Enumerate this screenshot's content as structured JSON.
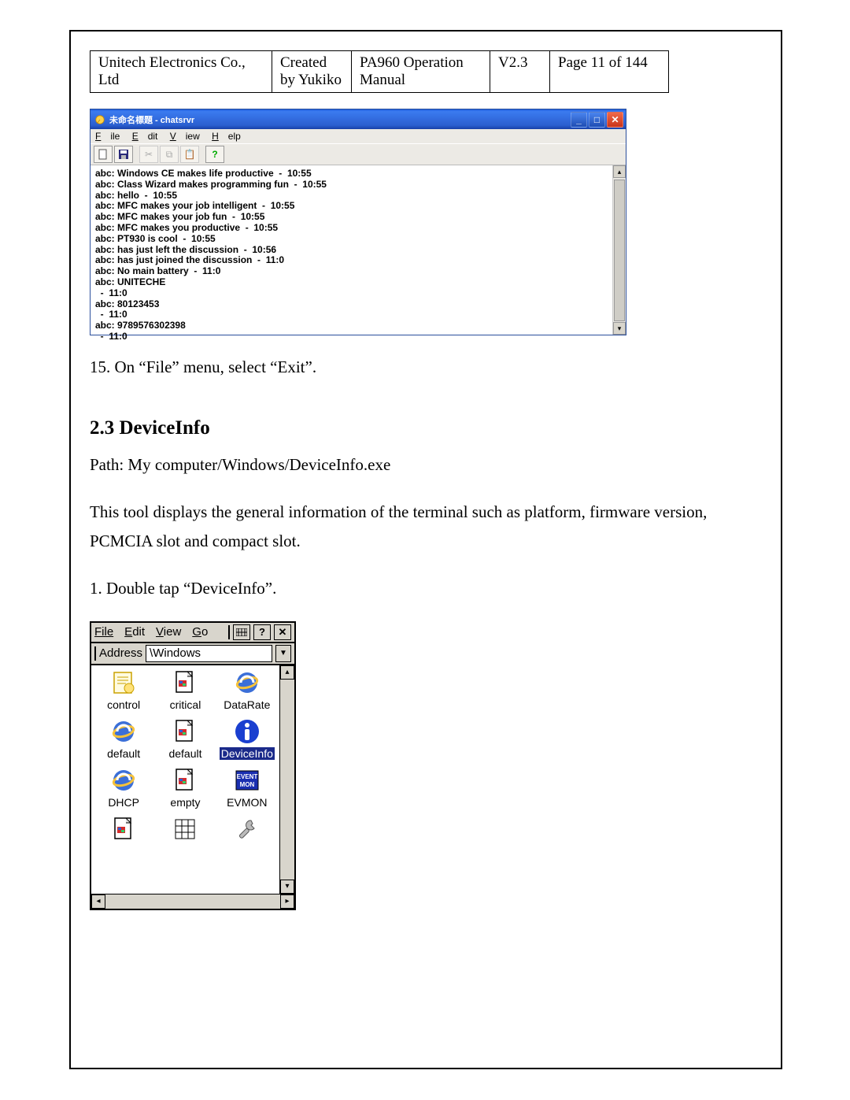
{
  "header": {
    "company": "Unitech Electronics Co., Ltd",
    "created1": "Created",
    "created2": "by Yukiko",
    "manual1": "PA960 Operation",
    "manual2": "Manual",
    "version": "V2.3",
    "page": "Page 11 of 144"
  },
  "xp": {
    "title": "未命名標題 - chatsrvr",
    "menus": {
      "file": "File",
      "edit": "Edit",
      "view": "View",
      "help": "Help"
    },
    "log": "abc: Windows CE makes life productive  -  10:55\nabc: Class Wizard makes programming fun  -  10:55\nabc: hello  -  10:55\nabc: MFC makes your job intelligent  -  10:55\nabc: MFC makes your job fun  -  10:55\nabc: MFC makes you productive  -  10:55\nabc: PT930 is cool  -  10:55\nabc: has just left the discussion  -  10:56\nabc: has just joined the discussion  -  11:0\nabc: No main battery  -  11:0\nabc: UNITECHE\n  -  11:0\nabc: 80123453\n  -  11:0\nabc: 9789576302398\n  -  11:0"
  },
  "text": {
    "step15": "15. On “File” menu, select “Exit”.",
    "section": "2.3   DeviceInfo",
    "path": "Path: My computer/Windows/DeviceInfo.exe",
    "desc": "This tool displays the general information of the terminal such as platform, firmware version, PCMCIA slot and compact slot.",
    "step1": "1. Double tap “DeviceInfo”."
  },
  "ce": {
    "menus": {
      "file": "File",
      "edit": "Edit",
      "view": "View",
      "go": "Go"
    },
    "addressLabel": "Address",
    "addressValue": "\\Windows",
    "items": [
      [
        {
          "name": "control",
          "ic": "script"
        },
        {
          "name": "critical",
          "ic": "doc"
        },
        {
          "name": "DataRate",
          "ic": "ie"
        }
      ],
      [
        {
          "name": "default",
          "ic": "ie"
        },
        {
          "name": "default",
          "ic": "doc"
        },
        {
          "name": "DeviceInfo",
          "ic": "info",
          "sel": true
        }
      ],
      [
        {
          "name": "DHCP",
          "ic": "ie"
        },
        {
          "name": "empty",
          "ic": "doc"
        },
        {
          "name": "EVMON",
          "ic": "evmon"
        }
      ],
      [
        {
          "name": "",
          "ic": "doc"
        },
        {
          "name": "",
          "ic": "grid"
        },
        {
          "name": "",
          "ic": "wrench"
        }
      ]
    ]
  }
}
